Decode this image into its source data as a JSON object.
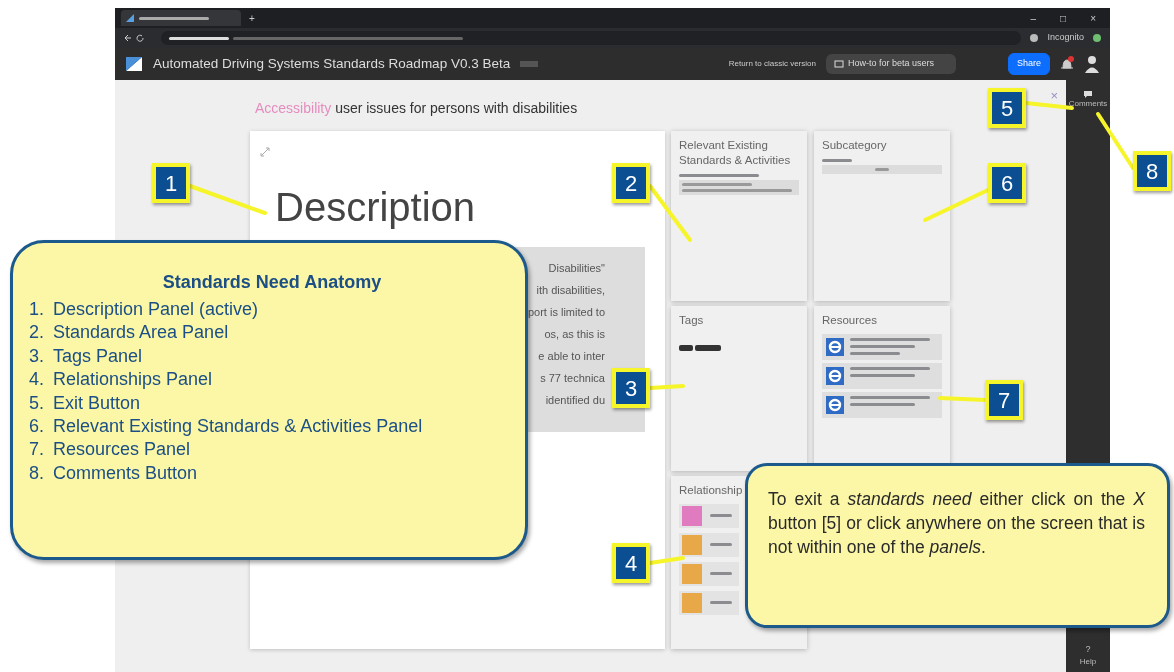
{
  "browser": {
    "new_tab": "+",
    "profile_label": "Incognito",
    "window_controls": [
      "–",
      "□",
      "×"
    ]
  },
  "app": {
    "title": "Automated Driving Systems Standards Roadmap V0.3 Beta",
    "return_link": "Return to classic version",
    "howto": "How-to for beta users",
    "share": "Share"
  },
  "heading": {
    "category": "Accessibility",
    "title": "user issues for persons with disabilities"
  },
  "description": {
    "title": "Description",
    "lines": [
      "Disabilities\"",
      "ith disabilities,",
      "port is limited to",
      "os, as this is",
      "e able to inter",
      "s 77 technica",
      "identified du"
    ]
  },
  "panels": [
    {
      "kind": "standards",
      "title": "Relevant Existing Standards & Activities"
    },
    {
      "kind": "subcategory",
      "title": "Subcategory"
    },
    {
      "kind": "tags",
      "title": "Tags"
    },
    {
      "kind": "resources",
      "title": "Resources"
    },
    {
      "kind": "relationships",
      "title": "Relationship",
      "items": [
        {
          "color": "#e07bbf"
        },
        {
          "color": "#e8a848"
        },
        {
          "color": "#e8a848"
        },
        {
          "color": "#e8a848"
        }
      ]
    }
  ],
  "exit_button": {
    "label": "×"
  },
  "sidebar": {
    "comments": "Comments",
    "help_icon": "?",
    "help": "Help"
  },
  "anatomy": {
    "title": "Standards Need Anatomy",
    "items": [
      {
        "number": "1.",
        "label": "Description Panel (active)"
      },
      {
        "number": "2.",
        "label": "Standards Area Panel"
      },
      {
        "number": "3.",
        "label": "Tags Panel"
      },
      {
        "number": "4.",
        "label": "Relationships Panel"
      },
      {
        "number": "5.",
        "label": "Exit Button"
      },
      {
        "number": "6.",
        "label": "Relevant Existing Standards & Activities Panel"
      },
      {
        "number": "7.",
        "label": "Resources Panel"
      },
      {
        "number": "8.",
        "label": "Comments Button"
      }
    ]
  },
  "exit_note": "To exit a *standards need* either click on the *X* button [5] or click anywhere on the screen that is not within one of the *panels*.",
  "markers": [
    "1",
    "2",
    "3",
    "4",
    "5",
    "6",
    "7",
    "8"
  ]
}
